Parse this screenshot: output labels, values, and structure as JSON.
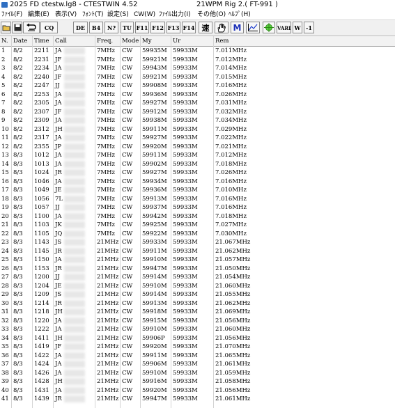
{
  "window": {
    "title": "2025 FD ctestw.lg8  - CTESTWIN  4.52",
    "status": "21WPM  Rig 2.( FT-991 )"
  },
  "menu": [
    "ﾌｧｲﾙ(F)",
    "編集(E)",
    "表示(V)",
    "ﾌｫﾝﾄ(T)",
    "設定(S)",
    "CW(W)",
    "ﾌｧｲﾙ出力(I)",
    "その他(O)",
    "ﾍﾙﾌﾟ(H)"
  ],
  "toolbar": {
    "buttons": [
      {
        "name": "open-file-icon",
        "label": ""
      },
      {
        "name": "save-icon",
        "label": ""
      },
      {
        "name": "undo-icon",
        "label": ""
      },
      {
        "name": "cq-button",
        "label": "CQ"
      },
      {
        "name": "de-button",
        "label": "DE"
      },
      {
        "name": "b4-button",
        "label": "B4"
      },
      {
        "name": "nt-button",
        "label": "N?"
      },
      {
        "name": "tu-button",
        "label": "TU"
      },
      {
        "name": "f11-button",
        "label": "F11"
      },
      {
        "name": "f12-button",
        "label": "F12"
      },
      {
        "name": "f13-button",
        "label": "F13"
      },
      {
        "name": "f14-button",
        "label": "F14"
      },
      {
        "name": "speed-button",
        "label": "速"
      },
      {
        "name": "hand-icon",
        "label": ""
      },
      {
        "name": "m-button",
        "label": "M"
      },
      {
        "name": "graph-icon",
        "label": ""
      },
      {
        "name": "target-icon",
        "label": ""
      },
      {
        "name": "vari-button",
        "label": "VARI"
      },
      {
        "name": "w-button",
        "label": "W"
      },
      {
        "name": "minus-one-button",
        "label": "-1"
      }
    ]
  },
  "grid": {
    "columns": [
      "N.",
      "Date",
      "Time",
      "Call",
      "Freq.",
      "Mode",
      "My",
      "Ur",
      "Rem"
    ],
    "rows": [
      [
        "1",
        "8/2",
        "2211",
        "JA",
        "7MHz",
        "CW",
        "59935M",
        "59933M",
        "7.011MHz"
      ],
      [
        "2",
        "8/2",
        "2231",
        "JF",
        "7MHz",
        "CW",
        "59921M",
        "59933M",
        "7.012MHz"
      ],
      [
        "3",
        "8/2",
        "2234",
        "JA",
        "7MHz",
        "CW",
        "59943M",
        "59933M",
        "7.014MHz"
      ],
      [
        "4",
        "8/2",
        "2240",
        "JF",
        "7MHz",
        "CW",
        "59921M",
        "59933M",
        "7.015MHz"
      ],
      [
        "5",
        "8/2",
        "2247",
        "JJ",
        "7MHz",
        "CW",
        "59908M",
        "59933M",
        "7.016MHz"
      ],
      [
        "6",
        "8/2",
        "2253",
        "JA",
        "7MHz",
        "CW",
        "59936M",
        "59933M",
        "7.026MHz"
      ],
      [
        "7",
        "8/2",
        "2305",
        "JA",
        "7MHz",
        "CW",
        "59927M",
        "59933M",
        "7.031MHz"
      ],
      [
        "8",
        "8/2",
        "2307",
        "JF",
        "7MHz",
        "CW",
        "59912M",
        "59933M",
        "7.032MHz"
      ],
      [
        "9",
        "8/2",
        "2309",
        "JA",
        "7MHz",
        "CW",
        "59938M",
        "59933M",
        "7.034MHz"
      ],
      [
        "10",
        "8/2",
        "2312",
        "JH",
        "7MHz",
        "CW",
        "59911M",
        "59933M",
        "7.029MHz"
      ],
      [
        "11",
        "8/2",
        "2317",
        "JA",
        "7MHz",
        "CW",
        "59927M",
        "59933M",
        "7.022MHz"
      ],
      [
        "12",
        "8/2",
        "2355",
        "JP",
        "7MHz",
        "CW",
        "59920M",
        "59933M",
        "7.021MHz"
      ],
      [
        "13",
        "8/3",
        "1012",
        "JA",
        "7MHz",
        "CW",
        "59911M",
        "59933M",
        "7.012MHz"
      ],
      [
        "14",
        "8/3",
        "1013",
        "JA",
        "7MHz",
        "CW",
        "59902M",
        "59933M",
        "7.018MHz"
      ],
      [
        "15",
        "8/3",
        "1024",
        "JR",
        "7MHz",
        "CW",
        "59927M",
        "59933M",
        "7.026MHz"
      ],
      [
        "16",
        "8/3",
        "1046",
        "JA",
        "7MHz",
        "CW",
        "59934M",
        "59933M",
        "7.016MHz"
      ],
      [
        "17",
        "8/3",
        "1049",
        "JE",
        "7MHz",
        "CW",
        "59936M",
        "59933M",
        "7.010MHz"
      ],
      [
        "18",
        "8/3",
        "1056",
        "7L",
        "7MHz",
        "CW",
        "59913M",
        "59933M",
        "7.016MHz"
      ],
      [
        "19",
        "8/3",
        "1057",
        "JJ",
        "7MHz",
        "CW",
        "59937M",
        "59933M",
        "7.016MHz"
      ],
      [
        "20",
        "8/3",
        "1100",
        "JA",
        "7MHz",
        "CW",
        "59942M",
        "59933M",
        "7.018MHz"
      ],
      [
        "21",
        "8/3",
        "1103",
        "JK",
        "7MHz",
        "CW",
        "59925M",
        "59933M",
        "7.027MHz"
      ],
      [
        "22",
        "8/3",
        "1105",
        "JQ",
        "7MHz",
        "CW",
        "59922M",
        "59933M",
        "7.030MHz"
      ],
      [
        "23",
        "8/3",
        "1143",
        "JS",
        "21MHz",
        "CW",
        "59933M",
        "59933M",
        "21.067MHz"
      ],
      [
        "24",
        "8/3",
        "1145",
        "JR",
        "21MHz",
        "CW",
        "59911M",
        "59933M",
        "21.062MHz"
      ],
      [
        "25",
        "8/3",
        "1150",
        "JA",
        "21MHz",
        "CW",
        "59910M",
        "59933M",
        "21.057MHz"
      ],
      [
        "26",
        "8/3",
        "1153",
        "JR",
        "21MHz",
        "CW",
        "59947M",
        "59933M",
        "21.050MHz"
      ],
      [
        "27",
        "8/3",
        "1200",
        "JJ",
        "21MHz",
        "CW",
        "59914M",
        "59933M",
        "21.054MHz"
      ],
      [
        "28",
        "8/3",
        "1204",
        "JE",
        "21MHz",
        "CW",
        "59910M",
        "59933M",
        "21.060MHz"
      ],
      [
        "29",
        "8/3",
        "1209",
        "JS",
        "21MHz",
        "CW",
        "59914M",
        "59933M",
        "21.055MHz"
      ],
      [
        "30",
        "8/3",
        "1214",
        "JR",
        "21MHz",
        "CW",
        "59913M",
        "59933M",
        "21.062MHz"
      ],
      [
        "31",
        "8/3",
        "1218",
        "JH",
        "21MHz",
        "CW",
        "59918M",
        "59933M",
        "21.069MHz"
      ],
      [
        "32",
        "8/3",
        "1220",
        "JA",
        "21MHz",
        "CW",
        "59915M",
        "59933M",
        "21.056MHz"
      ],
      [
        "33",
        "8/3",
        "1222",
        "JA",
        "21MHz",
        "CW",
        "59910M",
        "59933M",
        "21.060MHz"
      ],
      [
        "34",
        "8/3",
        "1411",
        "JH",
        "21MHz",
        "CW",
        "59906P",
        "59933M",
        "21.056MHz"
      ],
      [
        "35",
        "8/3",
        "1419",
        "JF",
        "21MHz",
        "CW",
        "59920M",
        "59933M",
        "21.070MHz"
      ],
      [
        "36",
        "8/3",
        "1422",
        "JA",
        "21MHz",
        "CW",
        "59911M",
        "59933M",
        "21.065MHz"
      ],
      [
        "37",
        "8/3",
        "1424",
        "JA",
        "21MHz",
        "CW",
        "59906M",
        "59933M",
        "21.061MHz"
      ],
      [
        "38",
        "8/3",
        "1426",
        "JA",
        "21MHz",
        "CW",
        "59910M",
        "59933M",
        "21.059MHz"
      ],
      [
        "39",
        "8/3",
        "1428",
        "JH",
        "21MHz",
        "CW",
        "59916M",
        "59933M",
        "21.058MHz"
      ],
      [
        "40",
        "8/3",
        "1431",
        "JA",
        "21MHz",
        "CW",
        "59920M",
        "59933M",
        "21.056MHz"
      ],
      [
        "41",
        "8/3",
        "1439",
        "JR",
        "21MHz",
        "CW",
        "59947M",
        "59933M",
        "21.061MHz"
      ]
    ]
  }
}
